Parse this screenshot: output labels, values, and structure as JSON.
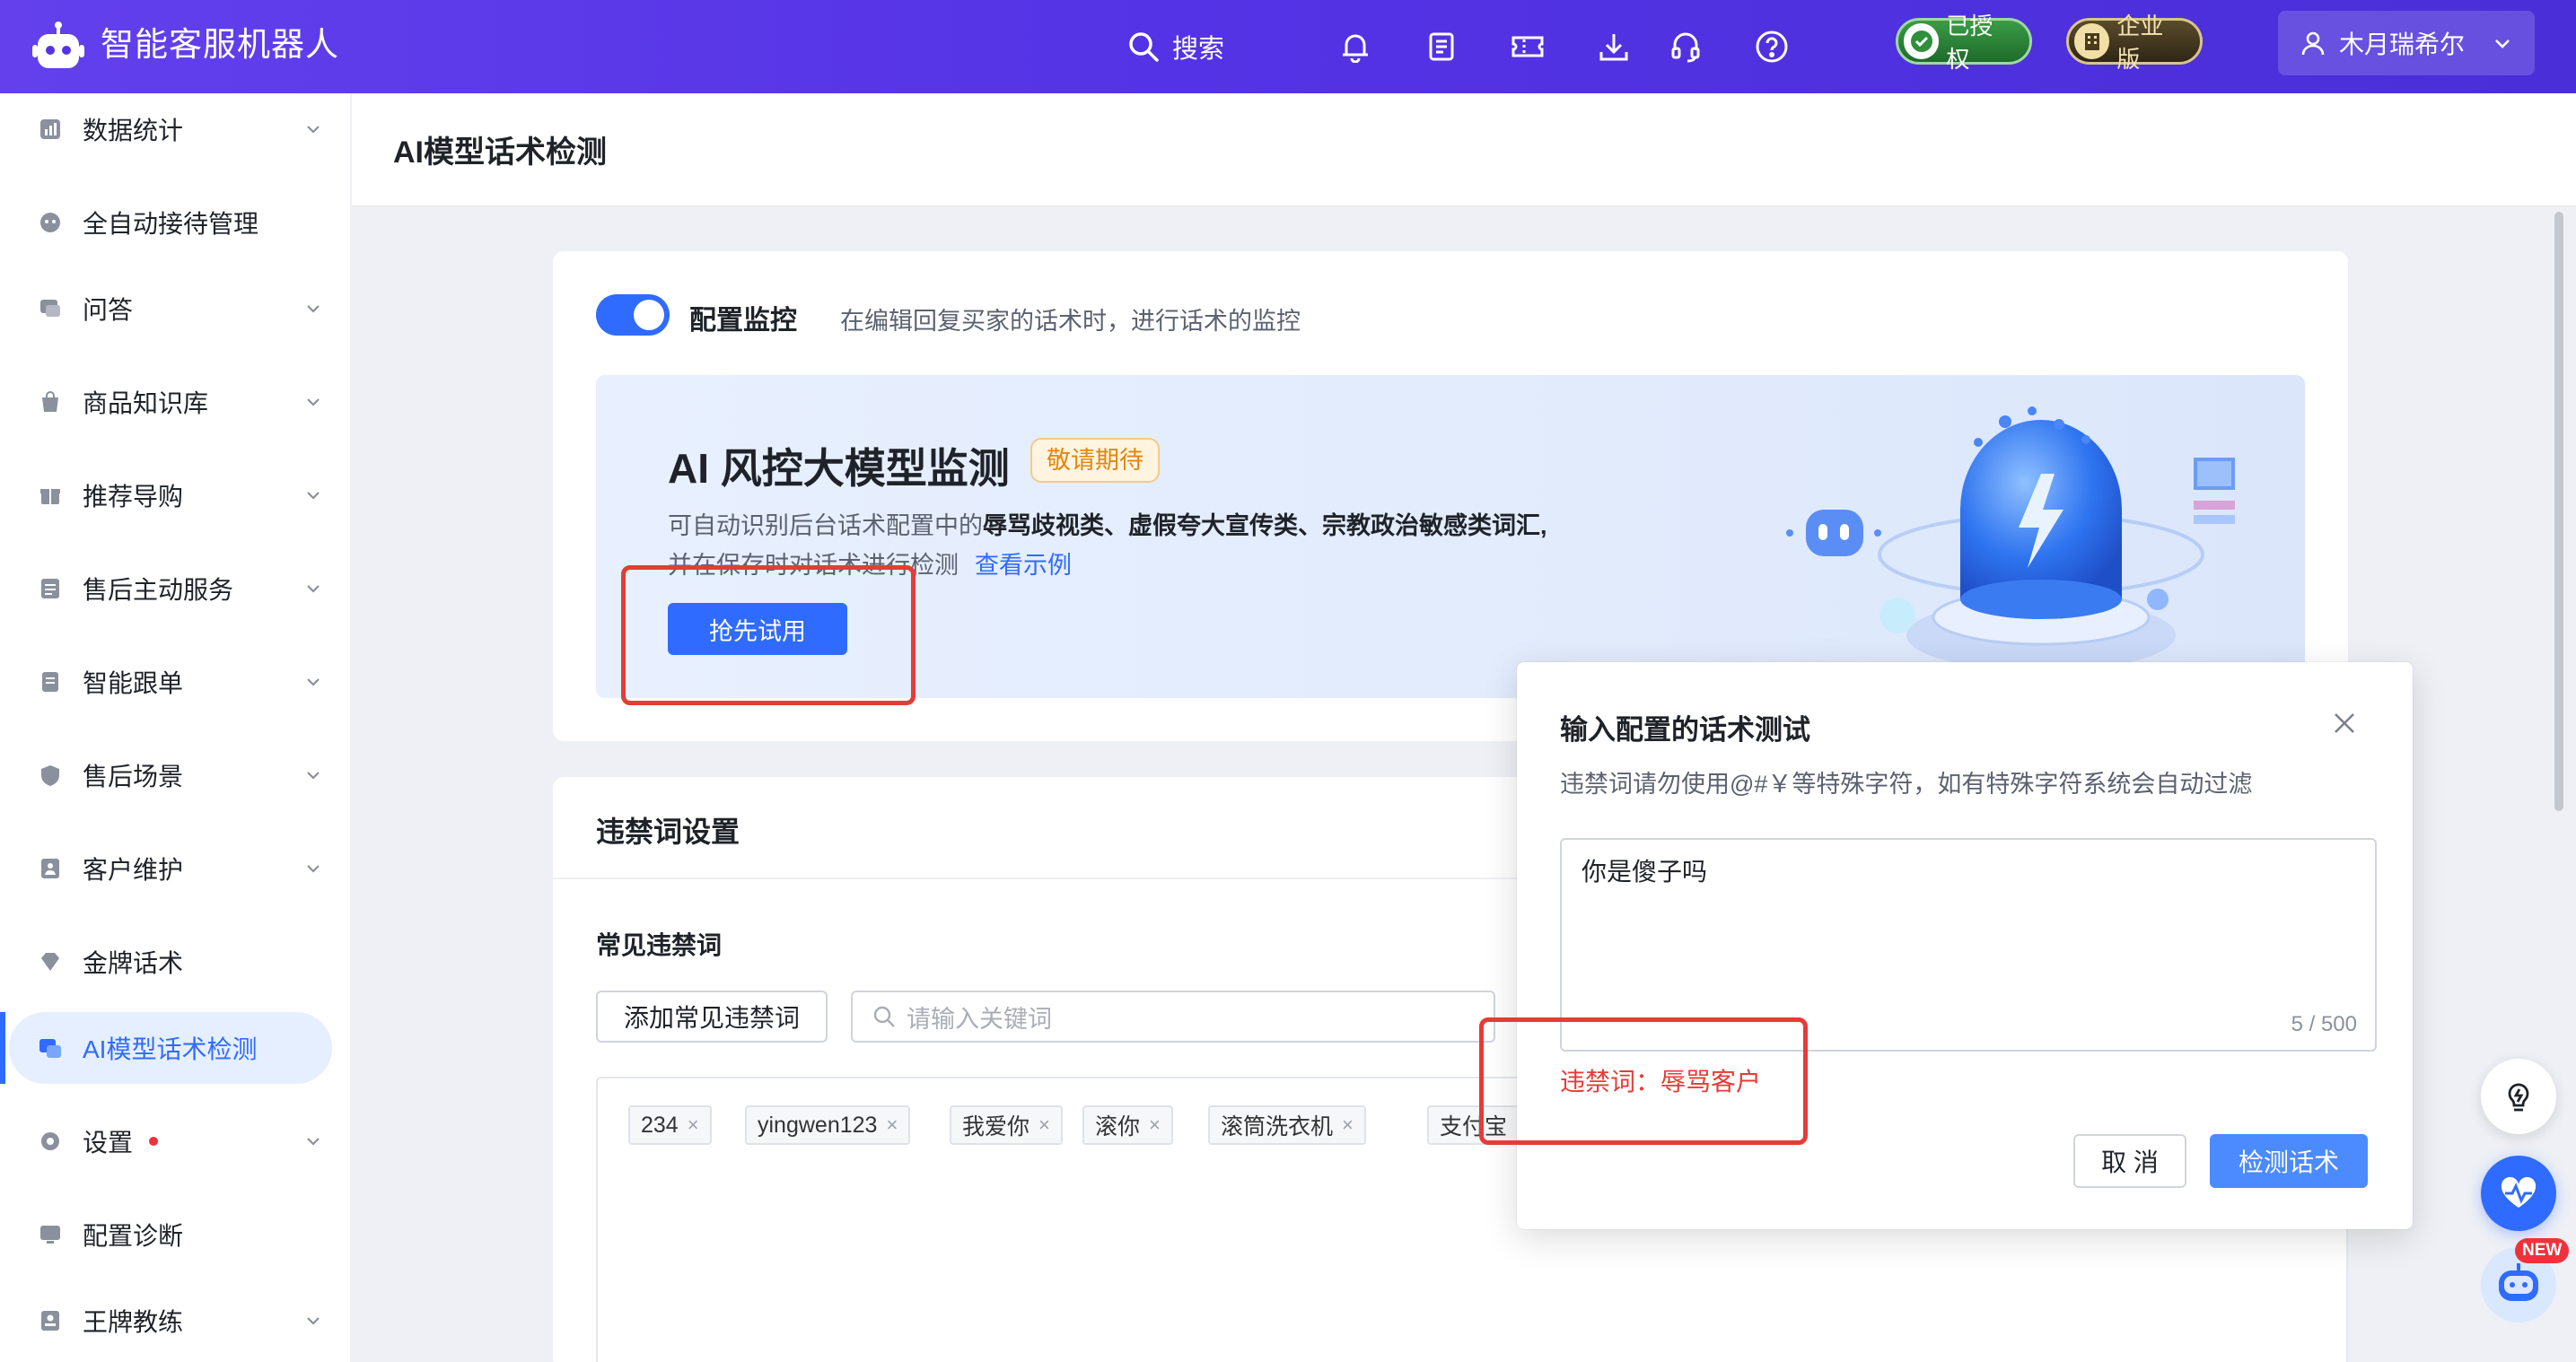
{
  "app": {
    "title": "智能客服机器人"
  },
  "header": {
    "search_label": "搜索",
    "icons": [
      "bell-icon",
      "task-list-icon",
      "ticket-icon",
      "download-icon",
      "headset-icon",
      "help-icon"
    ],
    "badge_authorized": "已授权",
    "badge_enterprise": "企业版",
    "user_name": "木月瑞希尔"
  },
  "sidebar": {
    "items": [
      {
        "label": "数据统计",
        "icon": "chart-icon",
        "expandable": true
      },
      {
        "label": "全自动接待管理",
        "icon": "robot-face-icon",
        "expandable": false
      },
      {
        "label": "问答",
        "icon": "chat-icon",
        "expandable": true
      },
      {
        "label": "商品知识库",
        "icon": "bag-icon",
        "expandable": true
      },
      {
        "label": "推荐导购",
        "icon": "gift-icon",
        "expandable": true
      },
      {
        "label": "售后主动服务",
        "icon": "list-icon",
        "expandable": true
      },
      {
        "label": "智能跟单",
        "icon": "document-icon",
        "expandable": true
      },
      {
        "label": "售后场景",
        "icon": "shield-icon",
        "expandable": true
      },
      {
        "label": "客户维护",
        "icon": "contacts-icon",
        "expandable": true
      },
      {
        "label": "金牌话术",
        "icon": "diamond-icon",
        "expandable": false
      },
      {
        "label": "AI模型话术检测",
        "icon": "ai-chat-icon",
        "expandable": false,
        "active": true
      },
      {
        "label": "设置",
        "icon": "gear-icon",
        "expandable": true,
        "dot": true
      },
      {
        "label": "配置诊断",
        "icon": "monitor-icon",
        "expandable": false
      },
      {
        "label": "王牌教练",
        "icon": "coach-icon",
        "expandable": true
      }
    ]
  },
  "page": {
    "title": "AI模型话术检测"
  },
  "monitor": {
    "label": "配置监控",
    "desc": "在编辑回复买家的话术时，进行话术的监控",
    "enabled": true
  },
  "banner": {
    "title": "AI 风控大模型监测",
    "badge": "敬请期待",
    "desc_prefix": "可自动识别后台话术配置中的",
    "desc_bold": "辱骂歧视类、虚假夸大宣传类、宗教政治敏感类词汇,",
    "desc_suffix": "并在保存时对话术进行检测",
    "link": "查看示例",
    "button": "抢先试用"
  },
  "banned": {
    "section_title": "违禁词设置",
    "common_title": "常见违禁词",
    "add_button": "添加常见违禁词",
    "search_placeholder": "请输入关键词",
    "tags": [
      "234",
      "yingwen123",
      "我爱你",
      "滚你",
      "滚筒洗衣机",
      "支付宝"
    ]
  },
  "modal": {
    "title": "输入配置的话术测试",
    "hint": "违禁词请勿使用@#￥等特殊字符，如有特殊字符系统会自动过滤",
    "input_value": "你是傻子吗",
    "char_count": "5 / 500",
    "result": "违禁词：辱骂客户",
    "cancel": "取 消",
    "detect": "检测话术"
  },
  "floating": {
    "new_badge": "NEW"
  },
  "colors": {
    "primary": "#2f6bff",
    "header": "#5433e6",
    "danger": "#e63b37",
    "warning": "#e3860b"
  }
}
